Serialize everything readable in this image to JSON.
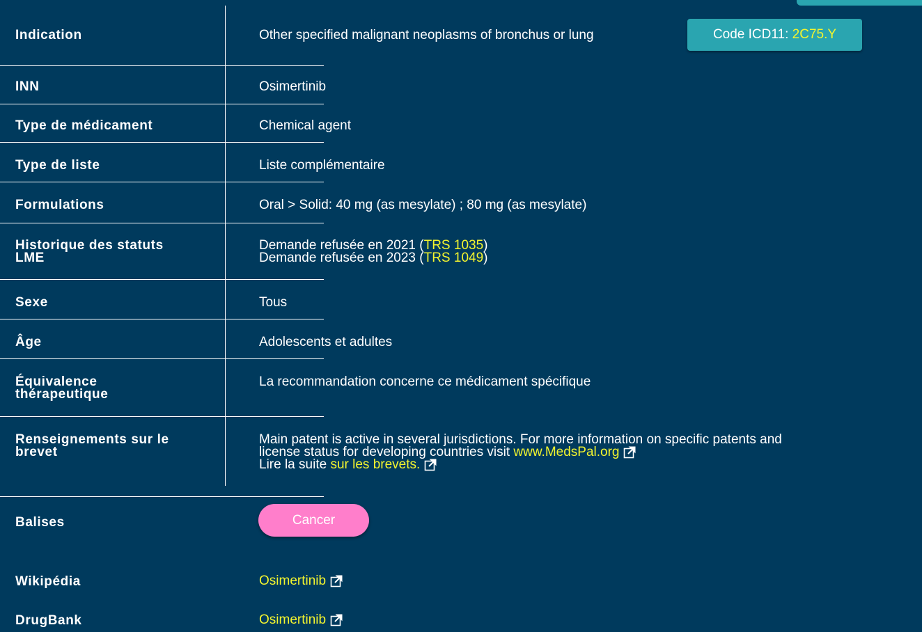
{
  "rows": {
    "indication": {
      "label": "Indication",
      "value": "Other specified malignant neoplasms of bronchus or lung"
    },
    "inn": {
      "label": "INN",
      "value": "Osimertinib"
    },
    "type_med": {
      "label": "Type de médicament",
      "value": "Chemical agent"
    },
    "type_liste": {
      "label": "Type de liste",
      "value": "Liste complémentaire"
    },
    "formulations": {
      "label": "Formulations",
      "value": "Oral > Solid: 40 mg (as mesylate) ; 80 mg (as mesylate)"
    },
    "historique": {
      "label_line1": "Historique des statuts",
      "label_line2": "LME",
      "line1_text": "Demande refusée en 2021 (",
      "line1_link": "TRS 1035",
      "line1_close": ")",
      "line2_text": "Demande refusée en 2023 (",
      "line2_link": "TRS 1049",
      "line2_close": ")"
    },
    "sexe": {
      "label": "Sexe",
      "value": "Tous"
    },
    "age": {
      "label": "Âge",
      "value": "Adolescents et adultes"
    },
    "equivalence": {
      "label_line1": "Équivalence",
      "label_line2": "thérapeutique",
      "value": "La recommandation concerne ce médicament spécifique"
    },
    "brevet": {
      "label_line1": "Renseignements sur le",
      "label_line2": "brevet",
      "line1": "Main patent is active in several jurisdictions. For more information on specific patents and",
      "line2_text": "license status for developing countries visit ",
      "line2_link": "www.MedsPal.org",
      "line3_text": "Lire la suite ",
      "line3_link": "sur les brevets."
    },
    "balises": {
      "label": "Balises",
      "tag": "Cancer"
    },
    "wikipedia": {
      "label": "Wikipédia",
      "link": "Osimertinib"
    },
    "drugbank": {
      "label": "DrugBank",
      "link": "Osimertinib"
    }
  },
  "icd": {
    "prefix": "Code ICD11: ",
    "code": "2C75.Y"
  },
  "colors": {
    "background": "#003a5d",
    "accent_teal": "#2aa5b0",
    "link_yellow": "#f3f52e",
    "tag_pink": "#ff7ecb"
  },
  "icons": {
    "external_link": "external-link-icon"
  }
}
